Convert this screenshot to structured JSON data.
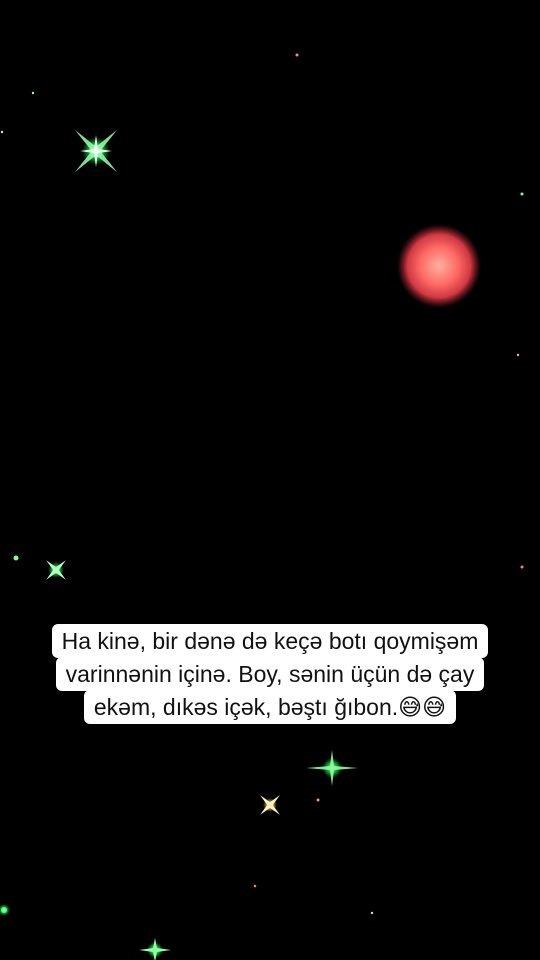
{
  "caption": {
    "lines": [
      "Ha kinə, bir dənə də keçə botı qoymişəm",
      "varinnənin içinə. Boy, sənin üçün də çay",
      "ekəm, dıkəs içək, bəştı ğıbon.😅😅"
    ]
  },
  "scene": {
    "background": "#000000",
    "planet_color": "#ff6b6b",
    "sparkle_color": "#7dff9a"
  }
}
